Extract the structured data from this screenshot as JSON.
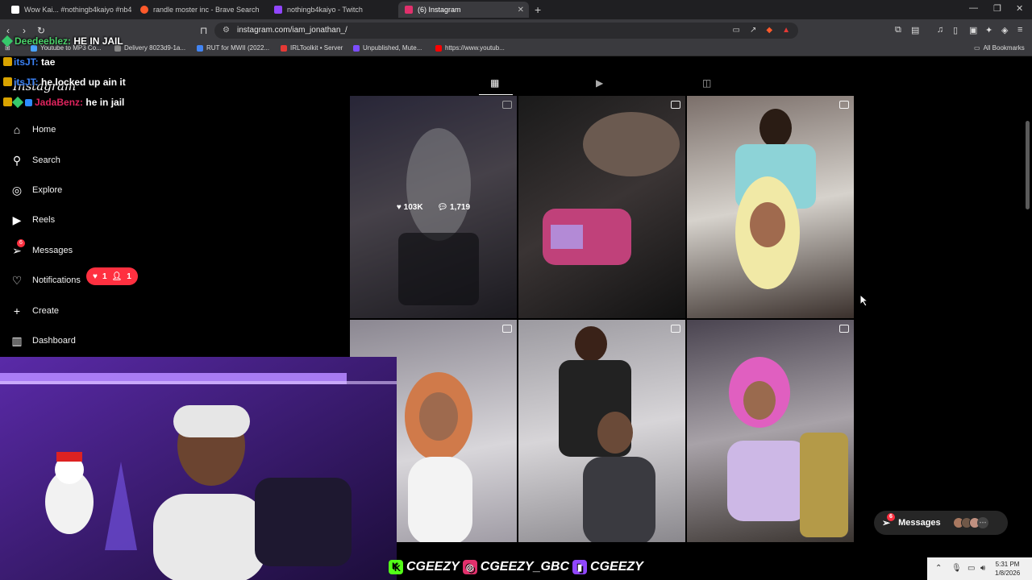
{
  "browser": {
    "tabs": [
      {
        "title": "Wow Kai... #nothingb4kaiyo #nb4 #",
        "color": "#000000"
      },
      {
        "title": "randle moster inc - Brave Search",
        "color": "#ff5a2b"
      },
      {
        "title": "nothingb4kaiyo - Twitch",
        "color": "#9146ff"
      },
      {
        "title": "(6) Instagram",
        "color": "#e1306c"
      }
    ],
    "url": "instagram.com/iam_jonathan_/",
    "bookmarks": [
      {
        "label": "Youtube to MP3 Co...",
        "color": "#4aa3ff"
      },
      {
        "label": "Delivery 8023d9-1a...",
        "color": "#888888"
      },
      {
        "label": "RUT for MWII (2022...",
        "color": "#4285f4"
      },
      {
        "label": "IRLToolkit • Server",
        "color": "#e53935"
      },
      {
        "label": "Unpublished, Mute...",
        "color": "#7c4dff"
      },
      {
        "label": "https://www.youtub...",
        "color": "#ff0000"
      }
    ],
    "all_bookmarks": "All Bookmarks"
  },
  "chat": [
    {
      "user": "Deedeeblez:",
      "color": "#4bd36b",
      "msg": "HE IN JAIL"
    },
    {
      "user": "itsJT:",
      "color": "#3b82f6",
      "msg": "tae"
    },
    {
      "user": "itsJT:",
      "color": "#3b82f6",
      "msg": "he locked up ain it"
    },
    {
      "user": "JadaBenz:",
      "color": "#e0245e",
      "msg": "he in jail"
    }
  ],
  "instagram": {
    "logo": "Instagram",
    "nav": {
      "home": "Home",
      "search": "Search",
      "explore": "Explore",
      "reels": "Reels",
      "messages": "Messages",
      "messages_badge": "6",
      "notifications": "Notifications",
      "create": "Create",
      "dashboard": "Dashboard"
    },
    "notif_pill": {
      "likes": "1",
      "follows": "1"
    },
    "hover": {
      "likes": "103K",
      "comments": "1,719"
    },
    "float_messages": {
      "label": "Messages",
      "badge": "6"
    }
  },
  "overlay": {
    "handle1": "CGEEZY",
    "handle2": "CGEEZY_GBC",
    "handle3": "CGEEZY"
  },
  "taskbar": {
    "time": "5:31 PM",
    "date": "1/8/2026"
  },
  "colors": {
    "accent": "#ff3040",
    "bg": "#000000"
  }
}
